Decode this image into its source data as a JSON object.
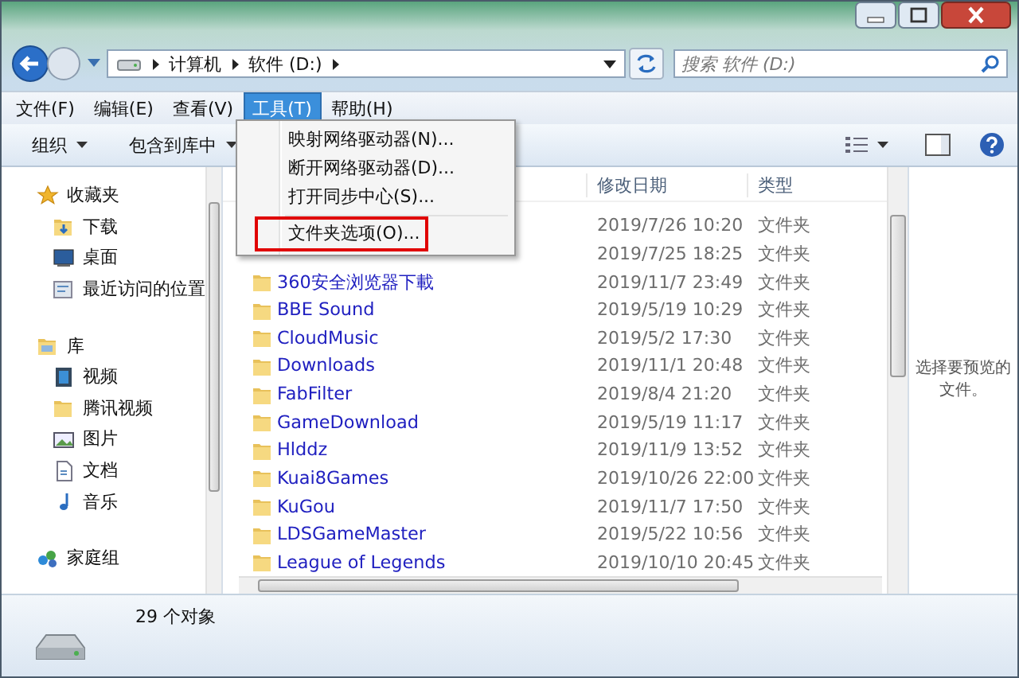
{
  "address": {
    "segments": [
      "计算机",
      "软件 (D:)"
    ]
  },
  "search": {
    "placeholder": "搜索 软件 (D:)"
  },
  "menubar": [
    {
      "label": "文件(F)",
      "selected": false
    },
    {
      "label": "编辑(E)",
      "selected": false
    },
    {
      "label": "查看(V)",
      "selected": false
    },
    {
      "label": "工具(T)",
      "selected": true
    },
    {
      "label": "帮助(H)",
      "selected": false
    }
  ],
  "menu": [
    {
      "label": "映射网络驱动器(N)...",
      "separator_before": false,
      "highlighted": false
    },
    {
      "label": "断开网络驱动器(D)...",
      "separator_before": false,
      "highlighted": false
    },
    {
      "label": "打开同步中心(S)...",
      "separator_before": false,
      "highlighted": false
    },
    {
      "label": "文件夹选项(O)...",
      "separator_before": true,
      "highlighted": true
    }
  ],
  "toolbar": [
    "组织",
    "包含到库中"
  ],
  "sidebar": [
    {
      "label": "收藏夹",
      "kind": "favorites",
      "children": [
        {
          "label": "下载",
          "kind": "download"
        },
        {
          "label": "桌面",
          "kind": "desktop"
        },
        {
          "label": "最近访问的位置",
          "kind": "recent"
        }
      ]
    },
    {
      "label": "库",
      "kind": "library",
      "children": [
        {
          "label": "视频",
          "kind": "video"
        },
        {
          "label": "腾讯视频",
          "kind": "folder"
        },
        {
          "label": "图片",
          "kind": "picture"
        },
        {
          "label": "文档",
          "kind": "document"
        },
        {
          "label": "音乐",
          "kind": "music"
        }
      ]
    },
    {
      "label": "家庭组",
      "kind": "homegroup"
    }
  ],
  "table": {
    "columns": [
      "修改日期",
      "类型"
    ],
    "rows": [
      {
        "date": "2019/7/26 10:20",
        "type": "文件夹"
      },
      {
        "date": "2019/7/25 18:25",
        "type": "文件夹"
      },
      {
        "name": "360安全浏览器下載",
        "date": "2019/11/7 23:49",
        "type": "文件夹"
      },
      {
        "name": "BBE Sound",
        "date": "2019/5/19 10:29",
        "type": "文件夹"
      },
      {
        "name": "CloudMusic",
        "date": "2019/5/2 17:30",
        "type": "文件夹"
      },
      {
        "name": "Downloads",
        "date": "2019/11/1 20:48",
        "type": "文件夹"
      },
      {
        "name": "FabFilter",
        "date": "2019/8/4 21:20",
        "type": "文件夹"
      },
      {
        "name": "GameDownload",
        "date": "2019/5/19 11:17",
        "type": "文件夹"
      },
      {
        "name": "Hlddz",
        "date": "2019/11/9 13:52",
        "type": "文件夹"
      },
      {
        "name": "Kuai8Games",
        "date": "2019/10/26 22:00",
        "type": "文件夹"
      },
      {
        "name": "KuGou",
        "date": "2019/11/7 17:50",
        "type": "文件夹"
      },
      {
        "name": "LDSGameMaster",
        "date": "2019/5/22 10:56",
        "type": "文件夹"
      },
      {
        "name": "League of Legends",
        "date": "2019/10/10 20:45",
        "type": "文件夹"
      }
    ]
  },
  "preview": {
    "message": "选择要预览的文件。"
  },
  "status_bar": {
    "count": "29 个对象"
  }
}
